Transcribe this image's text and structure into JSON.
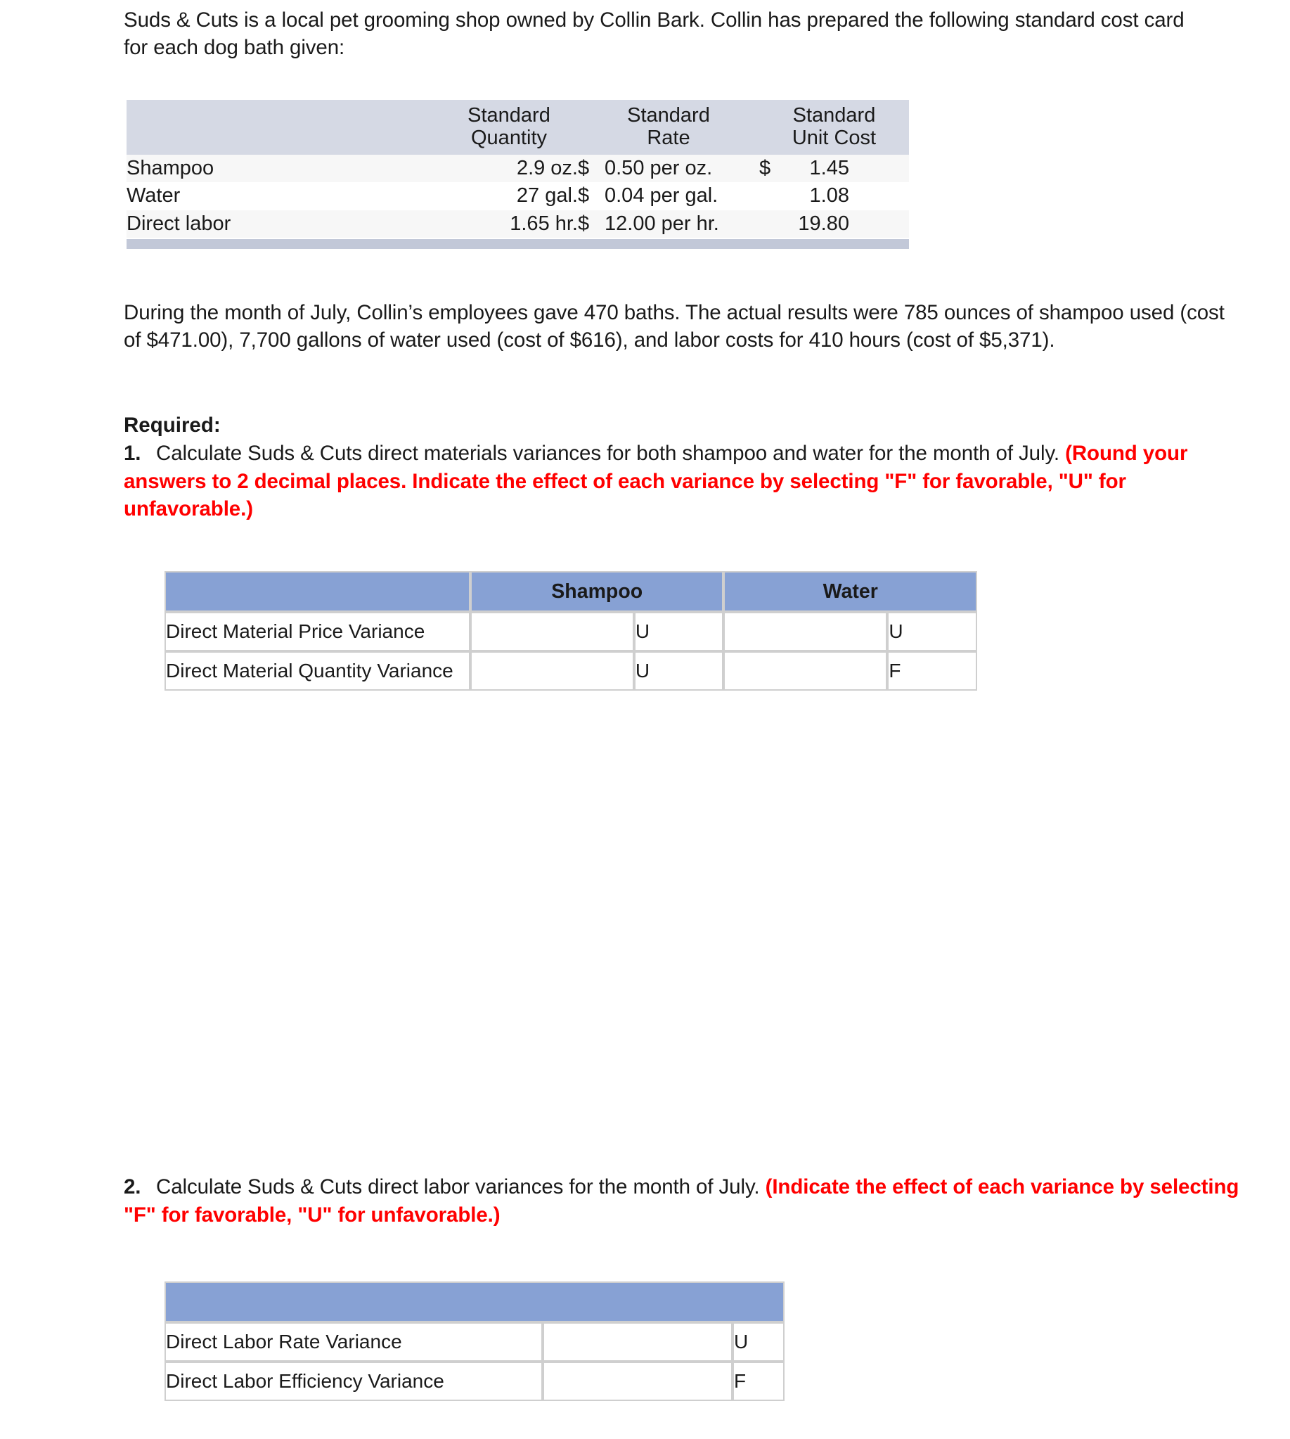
{
  "intro": {
    "text": "Suds & Cuts is a local pet grooming shop owned by Collin Bark. Collin has prepared the following standard cost card for each dog bath given:"
  },
  "cost_card": {
    "headers": [
      "",
      "Standard Quantity",
      "Standard Rate",
      "Standard Unit Cost"
    ],
    "header_lines": {
      "col2_line1": "Standard",
      "col2_line2": "Quantity",
      "col3_line1": "Standard",
      "col3_line2": "Rate",
      "col4_line1": "Standard",
      "col4_line2": "Unit Cost"
    },
    "rows": [
      {
        "label": "Shampoo",
        "std_quantity": "2.9 oz.",
        "rate_symbol": "$",
        "rate_value": "0.50 per oz.",
        "unit_symbol": "$",
        "unit_value": "1.45"
      },
      {
        "label": "Water",
        "std_quantity": "27 gal.",
        "rate_symbol": "$",
        "rate_value": "0.04 per gal.",
        "unit_symbol": "",
        "unit_value": "1.08"
      },
      {
        "label": "Direct labor",
        "std_quantity": "1.65 hr.",
        "rate_symbol": "$",
        "rate_value": "12.00 per hr.",
        "unit_symbol": "",
        "unit_value": "19.80"
      }
    ]
  },
  "actuals": {
    "text": "During the month of July, Collin’s employees gave 470 baths. The actual results were 785 ounces of shampoo used (cost of $471.00), 7,700 gallons of water used (cost of $616), and labor costs for 410 hours (cost of $5,371)."
  },
  "required": {
    "heading": "Required:",
    "items": [
      {
        "number": "1.",
        "black_text": "Calculate Suds & Cuts direct materials variances for both shampoo and water for the month of July. ",
        "red_text": "(Round your answers to 2 decimal places. Indicate the effect of each variance by selecting \"F\" for favorable, \"U\" for unfavorable.)"
      },
      {
        "number": "2.",
        "black_text": "Calculate Suds & Cuts direct labor variances for the month of July. ",
        "red_text": "(Indicate the effect of each variance by selecting \"F\" for favorable, \"U\" for unfavorable.)"
      }
    ]
  },
  "answer_table_1": {
    "headers": [
      "",
      "Shampoo",
      "Water"
    ],
    "rows": [
      {
        "label": "Direct Material Price Variance",
        "shampoo_value": "",
        "shampoo_effect": "U",
        "water_value": "",
        "water_effect": "U"
      },
      {
        "label": "Direct Material Quantity Variance",
        "shampoo_value": "",
        "shampoo_effect": "U",
        "water_value": "",
        "water_effect": "F"
      }
    ]
  },
  "answer_table_2": {
    "header": "",
    "rows": [
      {
        "label": "Direct Labor Rate Variance",
        "value": "",
        "effect": "U"
      },
      {
        "label": "Direct Labor Efficiency Variance",
        "value": "",
        "effect": "F"
      }
    ]
  },
  "colors": {
    "header_blue": "#87a1d4",
    "cost_card_header": "#d5d9e4",
    "cost_card_footbar": "#c2c8d8",
    "input_border_yellow": "#ffff00",
    "instruction_red": "#ff0000"
  }
}
